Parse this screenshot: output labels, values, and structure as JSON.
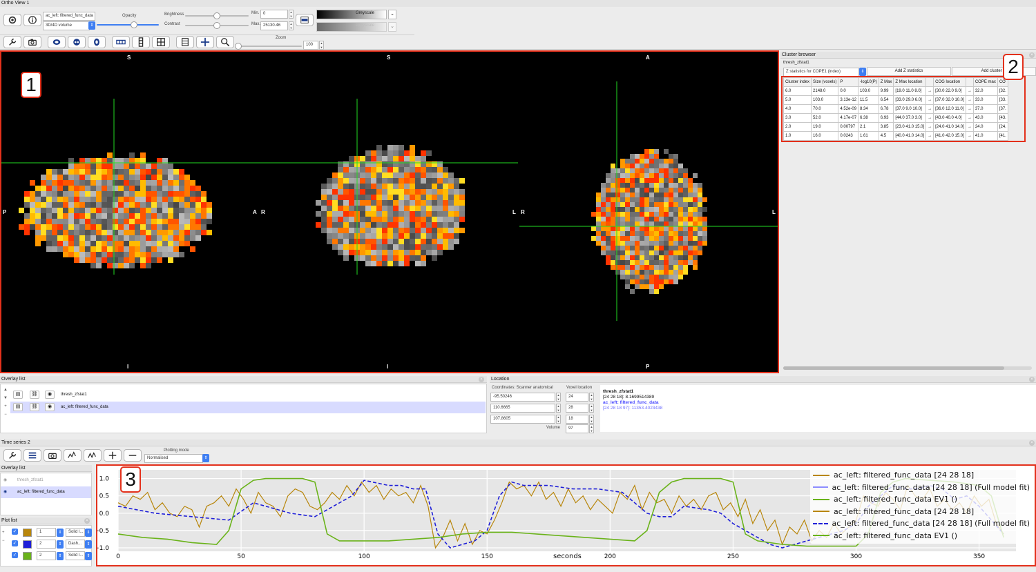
{
  "window": {
    "title": "Ortho View 1"
  },
  "toolbar": {
    "overlay_name": "ac_left: filtered_func_data",
    "overlay_type": "3D/4D volume",
    "opacity_label": "Opacity",
    "brightness_label": "Brightness",
    "contrast_label": "Contrast",
    "min_label": "Min.",
    "max_label": "Max.",
    "min_value": "0",
    "max_value": "25130.46",
    "cmap1": "Greyscale",
    "cmap2": "Greyscale",
    "zoom_label": "Zoom",
    "zoom_value": "100",
    "opacity_level": 0.6,
    "brightness_level": 0.5,
    "contrast_level": 0.5,
    "zoom_level": 0.0
  },
  "ortho": {
    "sagittal": {
      "top": "S",
      "bottom": "I",
      "left": "P",
      "right": "A"
    },
    "coronal": {
      "top": "S",
      "bottom": "I",
      "left": "R",
      "right": "L"
    },
    "axial": {
      "top": "A",
      "bottom": "P",
      "left": "R",
      "right": "L"
    },
    "badge": "1"
  },
  "cluster_browser": {
    "title": "Cluster browser",
    "image_name": "thresh_zfstat1",
    "dropdown": "Z statistics for COPE1 (index)",
    "add_z_button": "Add Z statistics",
    "add_cluster_button": "Add cluster m",
    "badge": "2",
    "columns": [
      "Cluster index",
      "Size (voxels)",
      "P",
      "-log10(P)",
      "Z Max",
      "Z Max location",
      "",
      "COG location",
      "",
      "COPE max",
      "CO"
    ],
    "rows": [
      [
        "6.0",
        "2148.0",
        "0.0",
        "103.0",
        "9.99",
        "[19.0 11.0 8.0]",
        "→",
        "[30.0 22.0 9.0]",
        "→",
        "32.0",
        "[32."
      ],
      [
        "5.0",
        "103.0",
        "3.13e-12",
        "11.5",
        "6.54",
        "[33.0 29.0 6.0]",
        "→",
        "[37.0 32.0 10.0]",
        "→",
        "33.0",
        "[33."
      ],
      [
        "4.0",
        "70.0",
        "4.52e-09",
        "8.34",
        "6.78",
        "[37.0 9.0 10.0]",
        "→",
        "[36.0 12.0 11.0]",
        "→",
        "37.0",
        "[37."
      ],
      [
        "3.0",
        "52.0",
        "4.17e-07",
        "6.38",
        "6.93",
        "[44.0 37.0 3.0]",
        "→",
        "[43.0 40.0 4.0]",
        "→",
        "43.0",
        "[43."
      ],
      [
        "2.0",
        "19.0",
        "0.00797",
        "2.1",
        "3.85",
        "[23.0 41.0 15.0]",
        "→",
        "[24.0 41.0 14.0]",
        "→",
        "24.0",
        "[24."
      ],
      [
        "1.0",
        "16.0",
        "0.0243",
        "1.61",
        "4.5",
        "[40.0 41.0 14.0]",
        "→",
        "[41.0 42.0 15.0]",
        "→",
        "41.0",
        "[41."
      ]
    ]
  },
  "overlay_list": {
    "title": "Overlay list",
    "items": [
      {
        "name": "thresh_zfstat1"
      },
      {
        "name": "ac_left: filtered_func_data"
      }
    ]
  },
  "location": {
    "title": "Location",
    "coords_label": "Coordinates: Scanner anatomical",
    "voxel_label": "Voxel location",
    "coords": [
      "-95.50246",
      "110.6665",
      "107.8605"
    ],
    "voxels": [
      "24",
      "28",
      "18"
    ],
    "volume_label": "Volume",
    "volume_value": "97",
    "info_title": "thresh_zfstat1",
    "info_line1": "[24 28 18]: 8.1699514389",
    "info_line2": "ac_left: filtered_func_data",
    "info_line3": "[24 28 18 97]: 11353.4023438"
  },
  "timeseries": {
    "title": "Time series 2",
    "plotting_mode_label": "Plotting mode",
    "plotting_mode_value": "Normalised",
    "badge": "3",
    "overlay_list_title": "Overlay list",
    "overlay_items": [
      "thresh_zfstat1",
      "ac_left: filtered_func_data"
    ],
    "plot_list_title": "Plot list",
    "plot_rows": [
      {
        "width": "1",
        "style": "Solid l...",
        "color": "#b8860b"
      },
      {
        "width": "2",
        "style": "Dash...",
        "color": "#1f1fd8"
      },
      {
        "width": "2",
        "style": "Solid l...",
        "color": "#6ab31a"
      }
    ]
  },
  "chart_data": {
    "type": "line",
    "xlabel": "seconds",
    "ylabel": "",
    "xlim": [
      0,
      365
    ],
    "ylim": [
      -1.1,
      1.25
    ],
    "xticks": [
      0,
      50,
      100,
      150,
      200,
      250,
      300,
      350
    ],
    "yticks": [
      1.0,
      0.5,
      0.0,
      -0.5,
      -1.0
    ],
    "ytick_labels": [
      "1.0",
      "0.5",
      "0.0",
      "−0.5",
      "−1.0"
    ],
    "grid": true,
    "legend_position": "top-right",
    "legend": [
      {
        "name": "ac_left: filtered_func_data [24 28 18]",
        "color": "#b8860b",
        "style": "solid"
      },
      {
        "name": "ac_left: filtered_func_data [24 28 18] (Full model fit)",
        "color": "#8c8cff",
        "style": "solid"
      },
      {
        "name": "ac_left: filtered_func_data EV1 ()",
        "color": "#6ab31a",
        "style": "solid"
      },
      {
        "name": "ac_left: filtered_func_data [24 28 18]",
        "color": "#b8860b",
        "style": "solid"
      },
      {
        "name": "ac_left: filtered_func_data [24 28 18] (Full model fit)",
        "color": "#1f1fd8",
        "style": "dashed"
      },
      {
        "name": "ac_left: filtered_func_data EV1 ()",
        "color": "#6ab31a",
        "style": "solid"
      }
    ],
    "series": [
      {
        "name": "ac_left: filtered_func_data [24 28 18]",
        "color": "#b8860b",
        "dash": false,
        "x": [
          0,
          3,
          6,
          9,
          12,
          15,
          18,
          21,
          24,
          27,
          30,
          33,
          36,
          39,
          42,
          45,
          48,
          51,
          54,
          57,
          60,
          63,
          66,
          69,
          72,
          75,
          78,
          81,
          84,
          87,
          90,
          93,
          96,
          99,
          102,
          105,
          108,
          111,
          114,
          117,
          120,
          123,
          126,
          129,
          132,
          135,
          138,
          141,
          144,
          147,
          150,
          153,
          156,
          159,
          162,
          165,
          168,
          171,
          174,
          177,
          180,
          183,
          186,
          189,
          192,
          195,
          198,
          201,
          204,
          207,
          210,
          213,
          216,
          219,
          222,
          225,
          228,
          231,
          234,
          237,
          240,
          243,
          246,
          249,
          252,
          255,
          258,
          261,
          264,
          267,
          270,
          273,
          276,
          279,
          282,
          285,
          288,
          291,
          294,
          297,
          300,
          303,
          306,
          309,
          312,
          315,
          318,
          321,
          324,
          327,
          330,
          333,
          336,
          339,
          342,
          345,
          348,
          351,
          354,
          357,
          360
        ],
        "y": [
          0.3,
          0.2,
          0.5,
          0.4,
          0.6,
          0.1,
          0.3,
          0.0,
          -0.1,
          0.2,
          0.1,
          -0.4,
          0.2,
          0.3,
          0.5,
          0.2,
          0.7,
          0.4,
          0.0,
          0.6,
          0.3,
          0.2,
          -0.1,
          0.5,
          0.7,
          0.6,
          0.2,
          0.1,
          0.3,
          0.6,
          0.4,
          0.8,
          0.5,
          0.9,
          0.6,
          0.8,
          0.4,
          0.7,
          0.5,
          0.6,
          0.3,
          0.8,
          0.2,
          -1.0,
          -0.7,
          -0.2,
          -0.8,
          -0.3,
          -0.9,
          -0.5,
          -0.6,
          -0.2,
          0.3,
          0.9,
          0.7,
          0.8,
          0.5,
          0.9,
          0.4,
          0.6,
          0.2,
          0.7,
          0.3,
          0.5,
          0.1,
          0.4,
          0.2,
          0.0,
          0.6,
          0.4,
          0.8,
          0.1,
          0.6,
          0.3,
          0.4,
          0.0,
          0.5,
          0.2,
          0.4,
          0.1,
          0.5,
          0.6,
          0.1,
          0.3,
          -0.1,
          0.4,
          -0.3,
          0.1,
          -0.5,
          -0.2,
          -0.9,
          -0.4,
          -0.6,
          -0.2,
          -0.8,
          -0.5,
          -0.7,
          -0.3,
          -0.6,
          -0.4,
          -0.2,
          0.5,
          0.3,
          0.2,
          0.6,
          0.4,
          0.1,
          0.8,
          0.5,
          0.4,
          0.7,
          0.2,
          0.4,
          0.1,
          0.3,
          0.0,
          0.5,
          0.2,
          0.4,
          -0.3,
          -0.6
        ]
      },
      {
        "name": "ac_left: filtered_func_data [24 28 18] (Full model fit)",
        "color": "#1f1fd8",
        "dash": true,
        "x": [
          0,
          15,
          30,
          45,
          55,
          60,
          70,
          80,
          95,
          100,
          110,
          115,
          120,
          125,
          130,
          135,
          140,
          145,
          150,
          155,
          160,
          165,
          175,
          185,
          195,
          205,
          210,
          215,
          220,
          225,
          230,
          240,
          245,
          250,
          255,
          265,
          270,
          275,
          280,
          285,
          290,
          295,
          300,
          305,
          310,
          315,
          320,
          325,
          330,
          335,
          340,
          345,
          350,
          360
        ],
        "y": [
          0.2,
          0.0,
          -0.1,
          -0.2,
          0.3,
          0.2,
          0.0,
          -0.1,
          0.5,
          0.95,
          0.8,
          0.8,
          0.7,
          0.7,
          -0.6,
          -1.0,
          -0.9,
          -0.8,
          -0.5,
          0.5,
          0.9,
          0.8,
          0.8,
          0.7,
          0.7,
          0.6,
          0.3,
          0.0,
          -0.1,
          -0.1,
          0.2,
          0.1,
          0.0,
          -0.3,
          -0.5,
          -0.9,
          -1.0,
          -0.9,
          -0.8,
          -0.7,
          -0.6,
          -0.5,
          -0.3,
          0.2,
          0.5,
          0.8,
          0.7,
          0.7,
          0.8,
          0.7,
          0.4,
          0.5,
          0.2,
          -0.6
        ]
      },
      {
        "name": "ac_left: filtered_func_data EV1 ()",
        "color": "#6ab31a",
        "dash": false,
        "x": [
          0,
          10,
          20,
          30,
          40,
          45,
          50,
          55,
          60,
          65,
          75,
          80,
          85,
          90,
          100,
          110,
          120,
          130,
          140,
          150,
          160,
          170,
          180,
          190,
          200,
          210,
          215,
          220,
          225,
          230,
          235,
          240,
          245,
          250,
          255,
          260,
          270,
          280,
          290,
          300,
          305,
          310,
          315,
          320,
          330,
          340,
          350,
          355,
          360
        ],
        "y": [
          -0.6,
          -0.7,
          -0.75,
          -0.85,
          -0.9,
          -0.5,
          0.7,
          0.95,
          1.0,
          1.0,
          1.0,
          0.9,
          -0.6,
          -0.8,
          -0.8,
          -0.8,
          -0.75,
          -0.7,
          -0.6,
          -0.55,
          -0.55,
          -0.6,
          -0.65,
          -0.7,
          -0.75,
          -0.8,
          -0.5,
          0.6,
          0.9,
          1.0,
          1.0,
          1.0,
          1.0,
          0.9,
          -0.6,
          -0.8,
          -0.9,
          -0.95,
          -0.95,
          -0.95,
          -0.6,
          0.6,
          0.9,
          1.0,
          0.95,
          0.9,
          0.8,
          0.5,
          -0.7
        ]
      }
    ]
  }
}
